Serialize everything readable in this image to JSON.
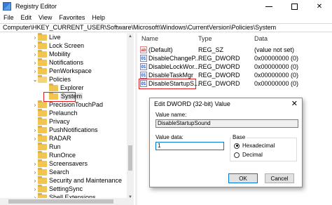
{
  "window": {
    "title": "Registry Editor"
  },
  "menu": [
    "File",
    "Edit",
    "View",
    "Favorites",
    "Help"
  ],
  "address": "Computer\\HKEY_CURRENT_USER\\Software\\Microsoft\\Windows\\CurrentVersion\\Policies\\System",
  "tree": [
    {
      "label": "Live",
      "chev": ">",
      "indent": 1
    },
    {
      "label": "Lock Screen",
      "chev": ">",
      "indent": 1
    },
    {
      "label": "Mobility",
      "chev": ">",
      "indent": 1
    },
    {
      "label": "Notifications",
      "chev": ">",
      "indent": 1
    },
    {
      "label": "PenWorkspace",
      "chev": ">",
      "indent": 1
    },
    {
      "label": "Policies",
      "chev": "v",
      "indent": 1
    },
    {
      "label": "Explorer",
      "chev": "",
      "indent": 2
    },
    {
      "label": "System",
      "chev": "",
      "indent": 2,
      "selected": true
    },
    {
      "label": "PrecisionTouchPad",
      "chev": ">",
      "indent": 1
    },
    {
      "label": "Prelaunch",
      "chev": "",
      "indent": 1
    },
    {
      "label": "Privacy",
      "chev": "",
      "indent": 1
    },
    {
      "label": "PushNotifications",
      "chev": ">",
      "indent": 1
    },
    {
      "label": "RADAR",
      "chev": ">",
      "indent": 1
    },
    {
      "label": "Run",
      "chev": "",
      "indent": 1
    },
    {
      "label": "RunOnce",
      "chev": "",
      "indent": 1
    },
    {
      "label": "Screensavers",
      "chev": ">",
      "indent": 1
    },
    {
      "label": "Search",
      "chev": ">",
      "indent": 1
    },
    {
      "label": "Security and Maintenance",
      "chev": ">",
      "indent": 1
    },
    {
      "label": "SettingSync",
      "chev": ">",
      "indent": 1
    },
    {
      "label": "Shell Extensions",
      "chev": ">",
      "indent": 1
    }
  ],
  "list": {
    "headers": {
      "name": "Name",
      "type": "Type",
      "data": "Data"
    },
    "rows": [
      {
        "icon": "ab",
        "kind": "sz",
        "name": "(Default)",
        "type": "REG_SZ",
        "data": "(value not set)"
      },
      {
        "icon": "01",
        "kind": "dword",
        "name": "DisableChangeP...",
        "type": "REG_DWORD",
        "data": "0x00000000 (0)"
      },
      {
        "icon": "01",
        "kind": "dword",
        "name": "DisableLockWor...",
        "type": "REG_DWORD",
        "data": "0x00000000 (0)"
      },
      {
        "icon": "01",
        "kind": "dword",
        "name": "DisableTaskMgr",
        "type": "REG_DWORD",
        "data": "0x00000000 (0)"
      },
      {
        "icon": "01",
        "kind": "dword",
        "name": "DisableStartupS...",
        "type": "REG_DWORD",
        "data": "0x00000000 (0)",
        "highlight": true
      }
    ]
  },
  "dialog": {
    "title": "Edit DWORD (32-bit) Value",
    "close": "✕",
    "value_name_label": "Value name:",
    "value_name": "DisableStartupSound",
    "value_data_label": "Value data:",
    "value_data": "1",
    "base_label": "Base",
    "base_options": [
      "Hexadecimal",
      "Decimal"
    ],
    "base_selected": "Hexadecimal",
    "ok": "OK",
    "cancel": "Cancel"
  },
  "colors": {
    "highlight_border": "#e02020",
    "accent": "#0078d7"
  }
}
